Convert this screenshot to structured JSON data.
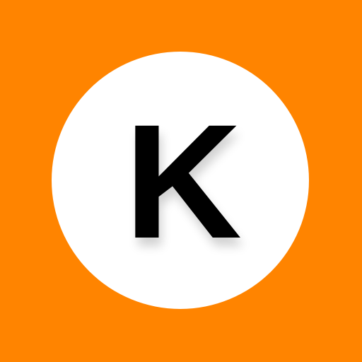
{
  "icon": {
    "letter": "K",
    "letter_icon": "letter-k-glyph",
    "colors": {
      "background": "#FF8400",
      "circle": "#FFFFFF",
      "letter": "#000000"
    }
  }
}
